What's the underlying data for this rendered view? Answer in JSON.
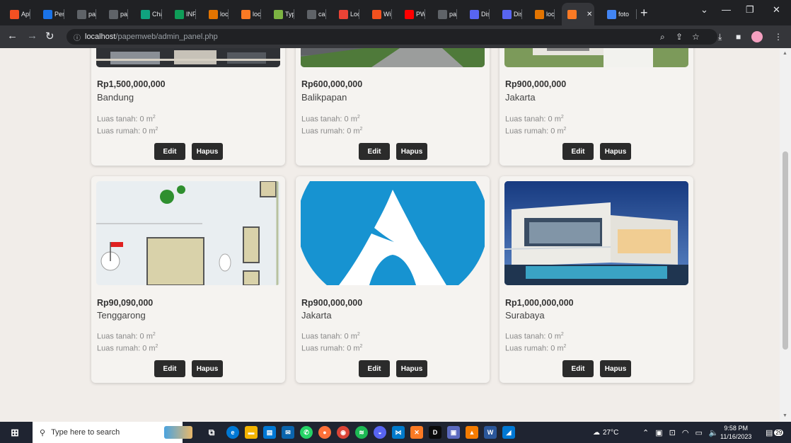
{
  "tabs": [
    {
      "label": "Apl",
      "color": "#f25022"
    },
    {
      "label": "Pen",
      "color": "#1a73e8"
    },
    {
      "label": "pat",
      "color": "#5f6368"
    },
    {
      "label": "pat",
      "color": "#5f6368"
    },
    {
      "label": "Cha",
      "color": "#10a37f"
    },
    {
      "label": "INF",
      "color": "#0f9d58"
    },
    {
      "label": "loc",
      "color": "#e37400"
    },
    {
      "label": "loc",
      "color": "#fb7a24"
    },
    {
      "label": "Typ",
      "color": "#7cb342"
    },
    {
      "label": "cah",
      "color": "#5f6368"
    },
    {
      "label": "Loc",
      "color": "#ea4335"
    },
    {
      "label": "Wi",
      "color": "#f4511e"
    },
    {
      "label": "PW",
      "color": "#ff0000"
    },
    {
      "label": "pat",
      "color": "#5f6368"
    },
    {
      "label": "Dis",
      "color": "#5865f2"
    },
    {
      "label": "Dis",
      "color": "#5865f2"
    },
    {
      "label": "loc",
      "color": "#e37400"
    },
    {
      "label": "",
      "color": "#fb7a24"
    },
    {
      "label": "foto",
      "color": "#4285f4"
    }
  ],
  "address": {
    "host": "localhost",
    "path": "/papemweb/admin_panel.php"
  },
  "labels": {
    "land_area": "Luas tanah: 0 m",
    "building_area": "Luas rumah: 0 m",
    "unit_sup": "2",
    "edit": "Edit",
    "delete": "Hapus"
  },
  "listings": [
    {
      "price": "Rp1,500,000,000",
      "city": "Bandung"
    },
    {
      "price": "Rp600,000,000",
      "city": "Balikpapan"
    },
    {
      "price": "Rp900,000,000",
      "city": "Jakarta"
    },
    {
      "price": "Rp90,090,000",
      "city": "Tenggarong"
    },
    {
      "price": "Rp900,000,000",
      "city": "Jakarta"
    },
    {
      "price": "Rp1,000,000,000",
      "city": "Surabaya"
    }
  ],
  "taskbar": {
    "search_placeholder": "Type here to search",
    "weather": "27°C",
    "time": "9:58 PM",
    "date": "11/16/2023",
    "notifications": "29"
  }
}
